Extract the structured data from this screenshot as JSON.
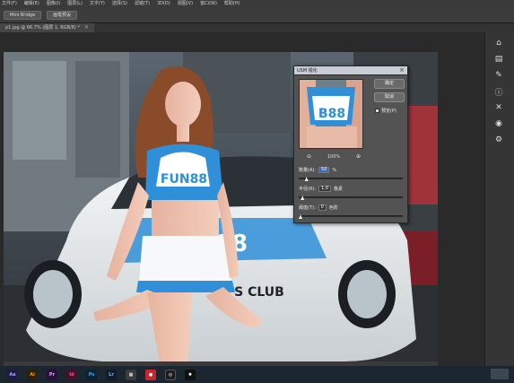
{
  "app": {
    "menu": [
      "文件(F)",
      "编辑(E)",
      "图像(I)",
      "图层(L)",
      "文字(Y)",
      "选择(S)",
      "滤镜(T)",
      "3D(D)",
      "视图(V)",
      "窗口(W)",
      "帮助(H)"
    ],
    "options": {
      "btn1": "Mini Bridge",
      "btn2": "画笔预设"
    },
    "document_tab": "p1.jpg @ 66.7% (图层 1, RGB/8) *"
  },
  "photo": {
    "shirt_text": "FUN88",
    "hood_text": "388",
    "stripe_text": "S CLUB"
  },
  "dialog": {
    "title": "USM 锐化",
    "ok": "确定",
    "cancel": "取消",
    "preview_label": "预览(P)",
    "zoom_percent": "100%",
    "amount_label": "数量(A):",
    "amount_value": "50",
    "amount_unit": "%",
    "radius_label": "半径(R):",
    "radius_value": "1.0",
    "radius_unit": "像素",
    "threshold_label": "阈值(T):",
    "threshold_value": "0",
    "threshold_unit": "色阶",
    "amount_slider": 0.06,
    "radius_slider": 0.02,
    "threshold_slider": 0.0
  },
  "colors": {
    "accent": "#2f8fd8",
    "field_selected": "#3b6bbf"
  },
  "icons": [
    "ae-icon",
    "ai-icon",
    "pr-icon",
    "id-icon",
    "ps-icon",
    "lr-icon",
    "explorer-icon",
    "red-app-icon",
    "camera-icon",
    "settings-icon"
  ]
}
